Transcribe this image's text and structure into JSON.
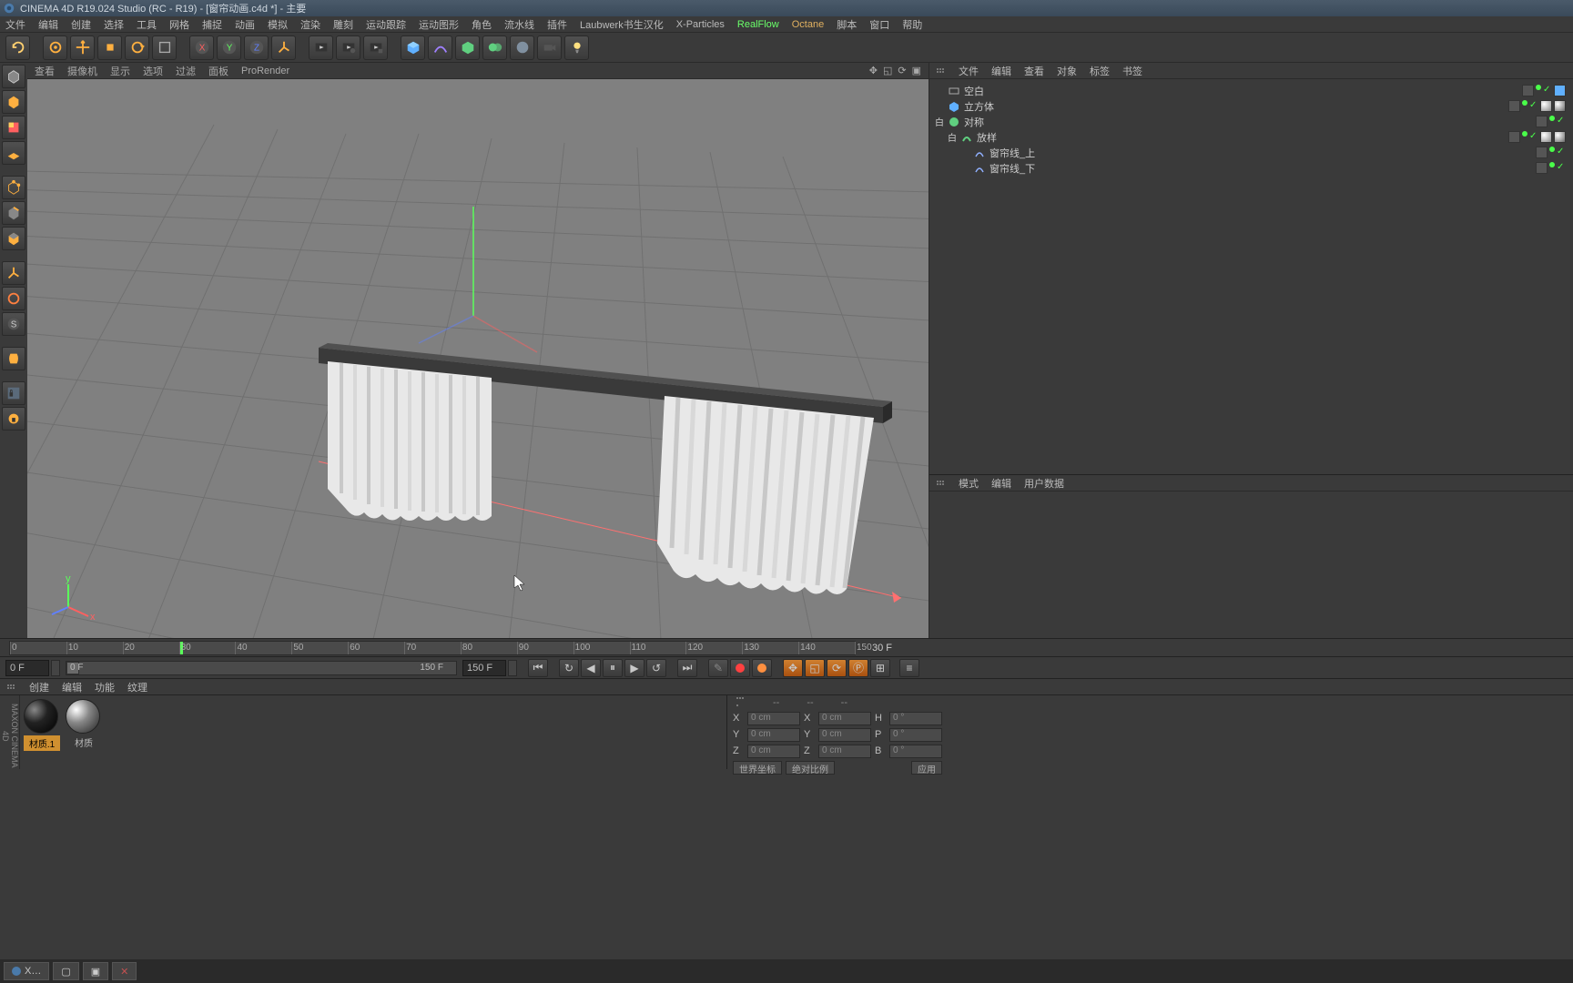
{
  "title_bar": {
    "title": "CINEMA 4D R19.024 Studio (RC - R19) - [窗帘动画.c4d *] - 主要"
  },
  "menu": {
    "items": [
      "文件",
      "编辑",
      "创建",
      "选择",
      "工具",
      "网格",
      "捕捉",
      "动画",
      "模拟",
      "渲染",
      "雕刻",
      "运动跟踪",
      "运动图形",
      "角色",
      "流水线",
      "插件",
      "Laubwerk书生汉化",
      "X-Particles",
      "RealFlow",
      "Octane",
      "脚本",
      "窗口",
      "帮助"
    ]
  },
  "vp_menu": {
    "items": [
      "查看",
      "摄像机",
      "显示",
      "选项",
      "过滤",
      "面板",
      "ProRender"
    ]
  },
  "obj_panel": {
    "tabs": [
      "文件",
      "编辑",
      "查看",
      "对象",
      "标签",
      "书签"
    ],
    "tree": [
      {
        "indent": 0,
        "exp": "",
        "icon": "null-icon",
        "name": "空白",
        "tags": [
          "layer",
          "dot",
          "check",
          "sel"
        ]
      },
      {
        "indent": 0,
        "exp": "",
        "icon": "cube-icon",
        "name": "立方体",
        "tags": [
          "layer",
          "dot",
          "check",
          "phong",
          "tex"
        ]
      },
      {
        "indent": 0,
        "exp": "白",
        "icon": "symmetry-icon",
        "name": "对称",
        "tags": [
          "layer",
          "dot",
          "check"
        ]
      },
      {
        "indent": 1,
        "exp": "白",
        "icon": "sweep-icon",
        "name": "放样",
        "tags": [
          "layer",
          "dot",
          "check",
          "phong",
          "tex"
        ]
      },
      {
        "indent": 2,
        "exp": "",
        "icon": "spline-icon",
        "name": "窗帘线_上",
        "tags": [
          "layer",
          "dot",
          "check"
        ]
      },
      {
        "indent": 2,
        "exp": "",
        "icon": "spline-icon",
        "name": "窗帘线_下",
        "tags": [
          "layer",
          "dot",
          "check"
        ]
      }
    ]
  },
  "attr_panel": {
    "tabs": [
      "模式",
      "编辑",
      "用户数据"
    ]
  },
  "timeline": {
    "ticks": [
      "0",
      "10",
      "20",
      "30",
      "40",
      "50",
      "60",
      "70",
      "80",
      "90",
      "100",
      "110",
      "120",
      "130",
      "140",
      "150"
    ],
    "current_label": "30 F",
    "head_pos_pct": 20
  },
  "transport": {
    "start_frame": "0 F",
    "left_frame": "0 F",
    "right_frame": "150 F",
    "end_frame": "150 F"
  },
  "mat_bar": {
    "items": [
      "创建",
      "编辑",
      "功能",
      "纹理"
    ]
  },
  "materials": [
    {
      "style": "dark",
      "label": "材质.1"
    },
    {
      "style": "light",
      "label": "材质"
    }
  ],
  "coord": {
    "head": [
      "--",
      "--",
      "--"
    ],
    "rows": [
      {
        "a": "X",
        "v1": "0 cm",
        "b": "X",
        "v2": "0 cm",
        "c": "H",
        "v3": "0 °"
      },
      {
        "a": "Y",
        "v1": "0 cm",
        "b": "Y",
        "v2": "0 cm",
        "c": "P",
        "v3": "0 °"
      },
      {
        "a": "Z",
        "v1": "0 cm",
        "b": "Z",
        "v2": "0 cm",
        "c": "B",
        "v3": "0 °"
      }
    ],
    "btn1": "世界坐标",
    "btn2": "绝对比例",
    "btn3": "应用"
  },
  "taskbar": {
    "item": "X…"
  }
}
